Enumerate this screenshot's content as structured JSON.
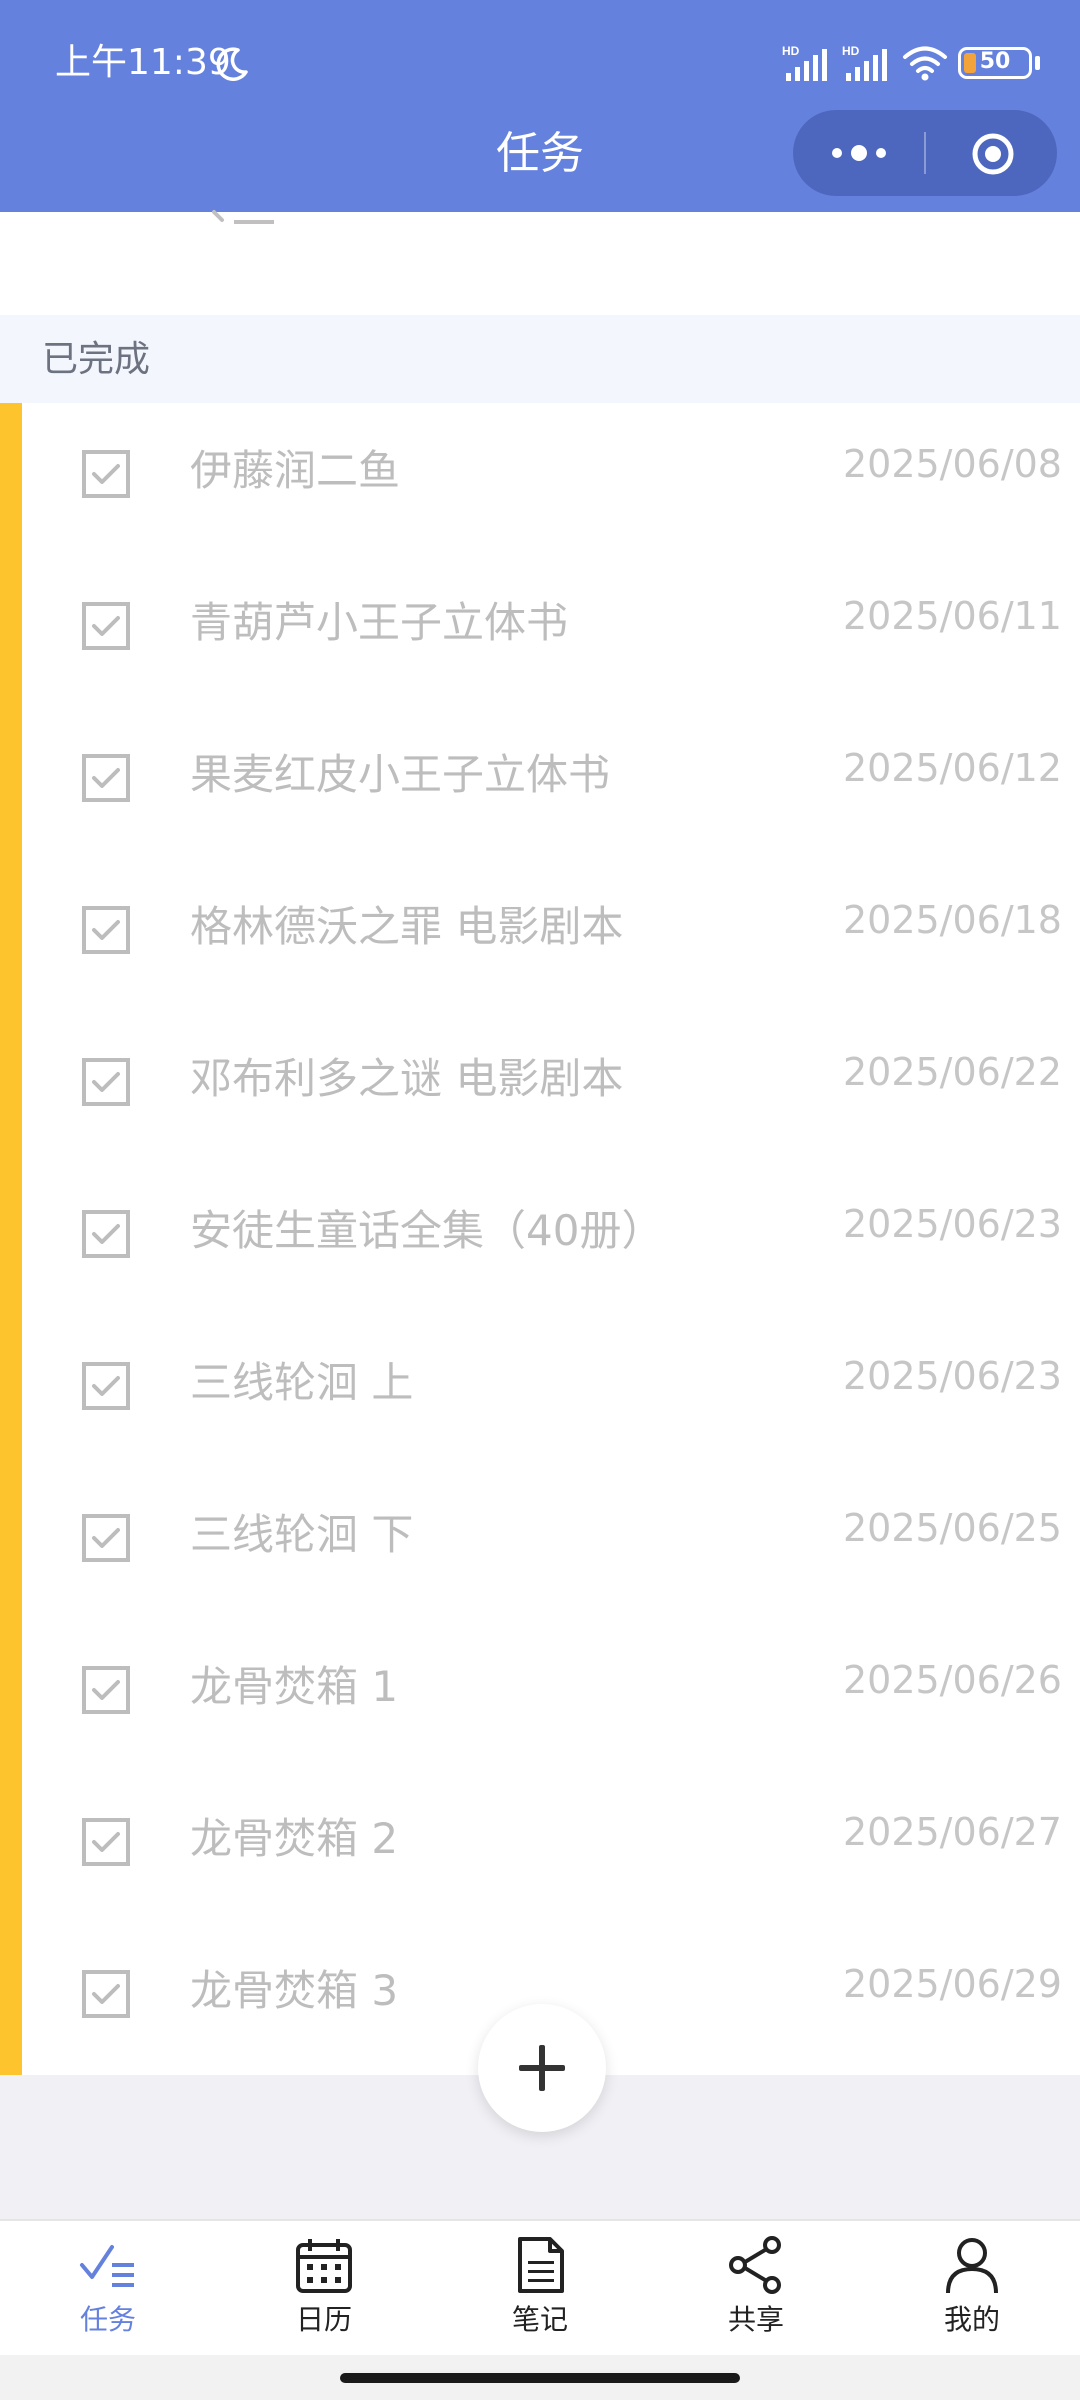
{
  "status_bar": {
    "time": "上午11:39",
    "signal_1_label": "HD",
    "signal_2_label": "HD",
    "battery": "50"
  },
  "header": {
    "title": "任务"
  },
  "section": {
    "title": "已完成"
  },
  "tasks": [
    {
      "title": "伊藤润二鱼",
      "date": "2025/06/08"
    },
    {
      "title": "青葫芦小王子立体书",
      "date": "2025/06/11"
    },
    {
      "title": "果麦红皮小王子立体书",
      "date": "2025/06/12"
    },
    {
      "title": "格林德沃之罪 电影剧本",
      "date": "2025/06/18"
    },
    {
      "title": "邓布利多之谜 电影剧本",
      "date": "2025/06/22"
    },
    {
      "title": "安徒生童话全集（40册）",
      "date": "2025/06/23"
    },
    {
      "title": "三线轮洄 上",
      "date": "2025/06/23"
    },
    {
      "title": "三线轮洄 下",
      "date": "2025/06/25"
    },
    {
      "title": "龙骨焚箱 1",
      "date": "2025/06/26"
    },
    {
      "title": "龙骨焚箱 2",
      "date": "2025/06/27"
    },
    {
      "title": "龙骨焚箱 3",
      "date": "2025/06/29"
    }
  ],
  "tabbar": {
    "tasks": "任务",
    "calendar": "日历",
    "notes": "笔记",
    "share": "共享",
    "mine": "我的"
  },
  "colors": {
    "header": "#6581DE",
    "accent_bar": "#FDC42E",
    "section_bg": "#F3F6FD",
    "active_tab": "#6581DE",
    "completed_text": "#BDBDBD"
  },
  "icons": {
    "moon": "moon-icon",
    "wifi": "wifi-icon",
    "more": "more-icon",
    "close": "target-close-icon",
    "check": "checked-checkbox-icon",
    "add": "plus-icon",
    "tab_tasks": "checklist-icon",
    "tab_calendar": "calendar-icon",
    "tab_notes": "document-icon",
    "tab_share": "share-icon",
    "tab_mine": "user-icon"
  }
}
